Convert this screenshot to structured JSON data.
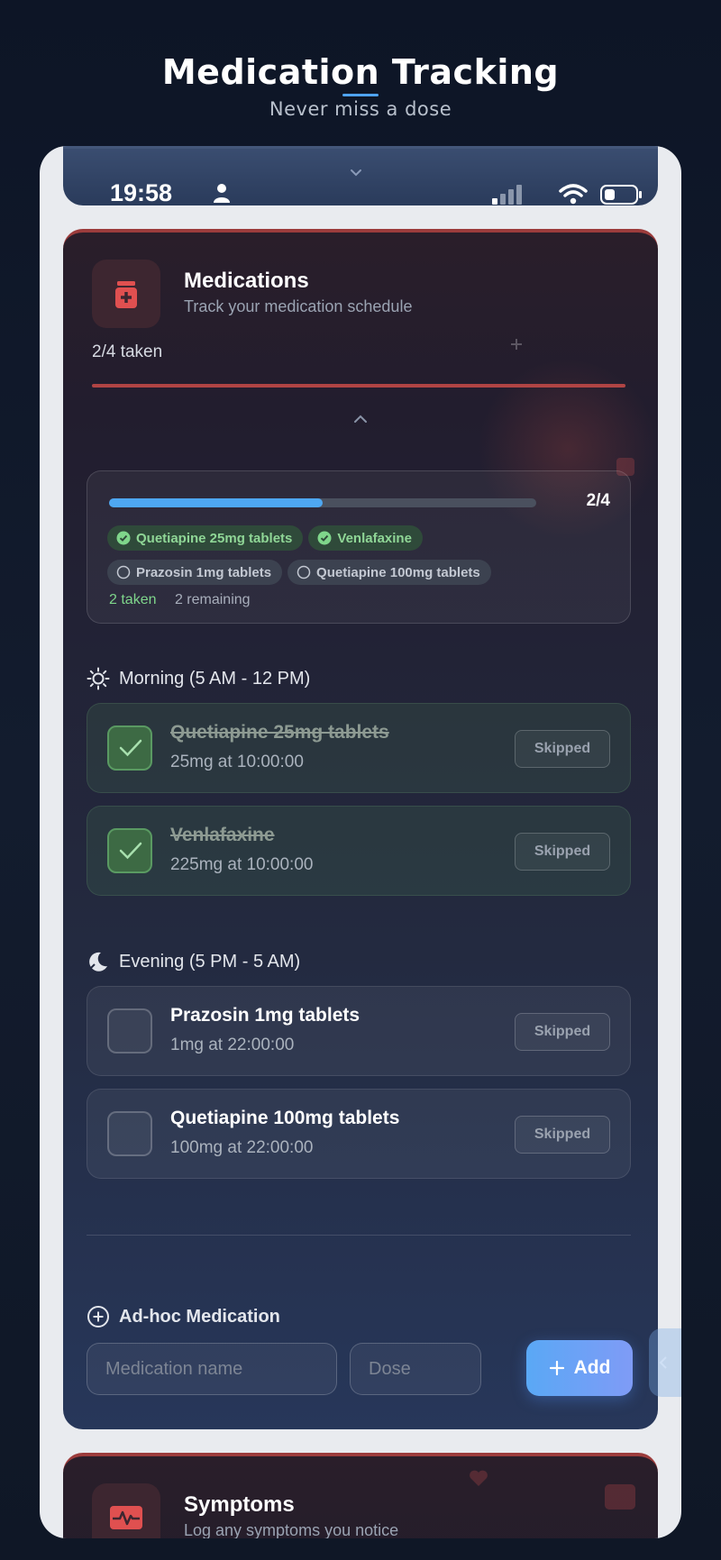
{
  "header": {
    "title": "Medication Tracking",
    "subtitle": "Never miss a dose"
  },
  "status_bar": {
    "time": "19:58",
    "icons": [
      "person-icon",
      "signal-icon",
      "wifi-icon",
      "battery-icon"
    ]
  },
  "medications_card": {
    "title": "Medications",
    "subtitle": "Track your medication schedule",
    "taken_label": "2/4 taken",
    "icon": "pill-bottle-icon",
    "summary": {
      "ratio": "2/4",
      "progress_fraction": 0.5,
      "chips": [
        {
          "label": "Quetiapine 25mg tablets",
          "status": "taken"
        },
        {
          "label": "Venlafaxine",
          "status": "taken"
        },
        {
          "label": "Prazosin 1mg tablets",
          "status": "pending"
        },
        {
          "label": "Quetiapine 100mg tablets",
          "status": "pending"
        }
      ],
      "taken_text": "2 taken",
      "remaining_text": "2 remaining"
    },
    "sections": [
      {
        "label": "Morning (5 AM - 12 PM)",
        "icon": "sun-icon",
        "items": [
          {
            "name": "Quetiapine 25mg tablets",
            "dose": "25mg at 10:00:00",
            "taken": true,
            "action": "Skipped"
          },
          {
            "name": "Venlafaxine",
            "dose": "225mg at 10:00:00",
            "taken": true,
            "action": "Skipped"
          }
        ]
      },
      {
        "label": "Evening (5 PM - 5 AM)",
        "icon": "moon-icon",
        "items": [
          {
            "name": "Prazosin 1mg tablets",
            "dose": "1mg at 22:00:00",
            "taken": false,
            "action": "Skipped"
          },
          {
            "name": "Quetiapine 100mg tablets",
            "dose": "100mg at 22:00:00",
            "taken": false,
            "action": "Skipped"
          }
        ]
      }
    ],
    "adhoc": {
      "label": "Ad-hoc Medication",
      "name_placeholder": "Medication name",
      "dose_placeholder": "Dose",
      "add_label": "Add"
    }
  },
  "symptoms_card": {
    "title": "Symptoms",
    "subtitle": "Log any symptoms you notice",
    "icon": "heartbeat-icon"
  },
  "colors": {
    "accent": "#4ea7f2",
    "taken_green": "#7fd68b",
    "card_accent": "#b04444"
  }
}
